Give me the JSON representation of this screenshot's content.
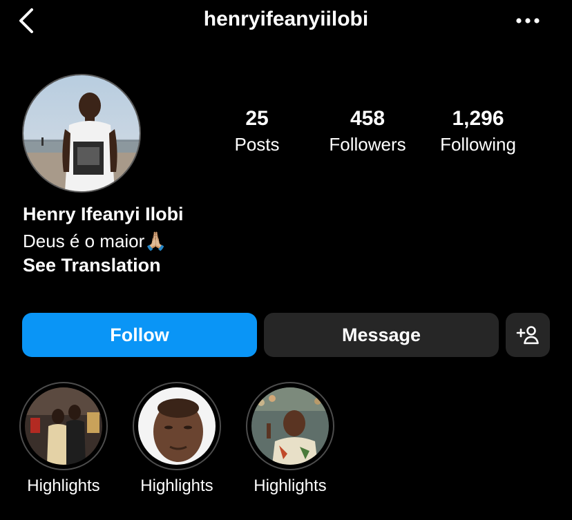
{
  "header": {
    "username": "henryifeanyiilobi",
    "back_icon": "chevron-left-icon",
    "more_icon": "more-horizontal-icon"
  },
  "profile": {
    "stats": {
      "posts_count": "25",
      "posts_label": "Posts",
      "followers_count": "458",
      "followers_label": "Followers",
      "following_count": "1,296",
      "following_label": "Following"
    },
    "full_name": "Henry Ifeanyi Ilobi",
    "bio": "Deus é o maior🙏🏼",
    "see_translation": "See Translation"
  },
  "actions": {
    "follow_label": "Follow",
    "message_label": "Message",
    "add_user_icon": "add-user-icon"
  },
  "highlights": [
    {
      "label": "Highlights"
    },
    {
      "label": "Highlights"
    },
    {
      "label": "Highlights"
    }
  ],
  "colors": {
    "background": "#000000",
    "follow_button": "#0a95f6",
    "secondary_button": "#262626",
    "text": "#ffffff"
  }
}
